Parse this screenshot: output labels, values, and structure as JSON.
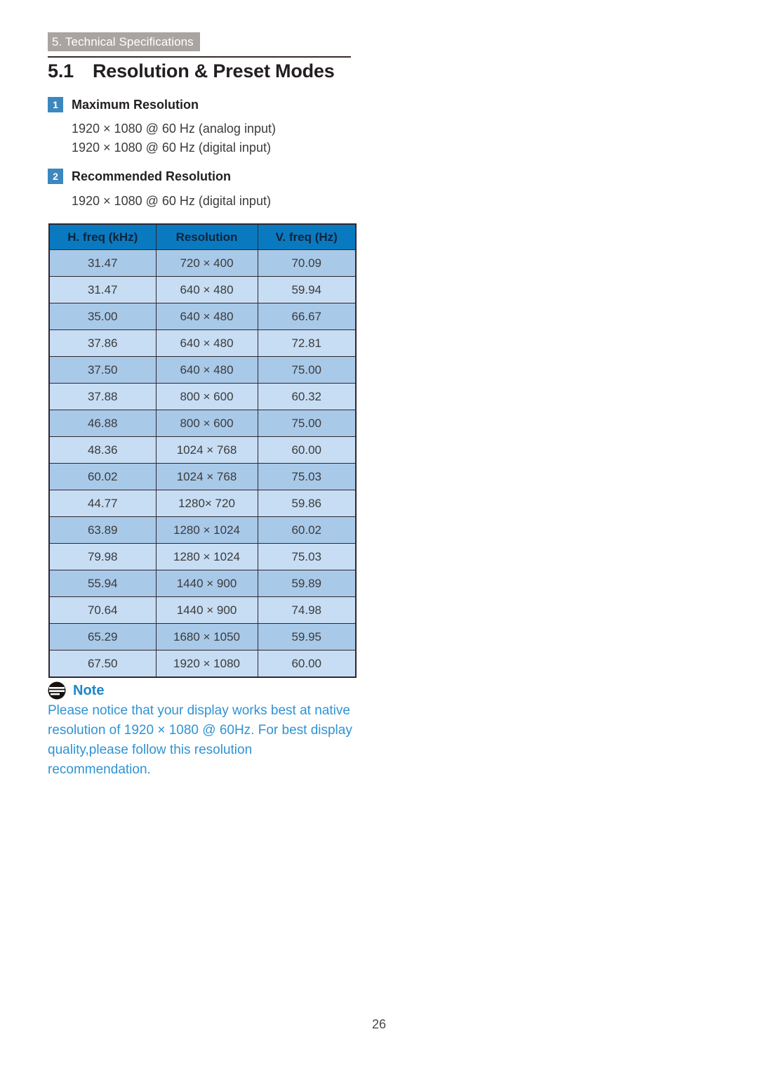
{
  "header": {
    "chapter_banner": "5. Technical Specifications"
  },
  "section": {
    "number": "5.1",
    "title": "Resolution & Preset Modes"
  },
  "items": [
    {
      "badge": "1",
      "label": "Maximum Resolution",
      "lines": [
        "1920 × 1080 @ 60 Hz (analog input)",
        "1920 × 1080 @ 60 Hz (digital input)"
      ]
    },
    {
      "badge": "2",
      "label": "Recommended Resolution",
      "lines": [
        "1920 × 1080 @ 60 Hz (digital input)"
      ]
    }
  ],
  "table": {
    "columns": [
      "H. freq (kHz)",
      "Resolution",
      "V. freq (Hz)"
    ],
    "rows": [
      [
        "31.47",
        "720 × 400",
        "70.09"
      ],
      [
        "31.47",
        "640 × 480",
        "59.94"
      ],
      [
        "35.00",
        "640 × 480",
        "66.67"
      ],
      [
        "37.86",
        "640 × 480",
        "72.81"
      ],
      [
        "37.50",
        "640 × 480",
        "75.00"
      ],
      [
        "37.88",
        "800 × 600",
        "60.32"
      ],
      [
        "46.88",
        "800 × 600",
        "75.00"
      ],
      [
        "48.36",
        "1024 × 768",
        "60.00"
      ],
      [
        "60.02",
        "1024 × 768",
        "75.03"
      ],
      [
        "44.77",
        "1280× 720",
        "59.86"
      ],
      [
        "63.89",
        "1280 × 1024",
        "60.02"
      ],
      [
        "79.98",
        "1280 × 1024",
        "75.03"
      ],
      [
        "55.94",
        "1440 × 900",
        "59.89"
      ],
      [
        "70.64",
        "1440 × 900",
        "74.98"
      ],
      [
        "65.29",
        "1680 × 1050",
        "59.95"
      ],
      [
        "67.50",
        "1920 × 1080",
        "60.00"
      ]
    ]
  },
  "note": {
    "icon": "note-icon",
    "title": "Note",
    "body": "Please notice that your display works best at native resolution of 1920 × 1080 @ 60Hz. For best display quality,please follow this resolution recommendation."
  },
  "footer": {
    "page_number": "26"
  },
  "colors": {
    "banner_gray": "#a9a4a1",
    "badge_blue": "#3d87bf",
    "table_header_blue": "#0a7ac0",
    "row_dark": "#a9c9e9",
    "row_light": "#c7ddf3",
    "note_blue": "#2f93d3",
    "rule_dark": "#3a2c28"
  }
}
